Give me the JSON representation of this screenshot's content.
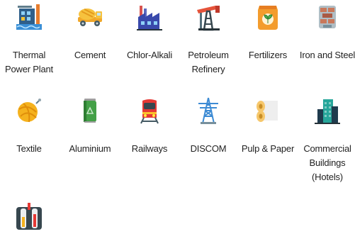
{
  "sectors": [
    {
      "label": "Thermal Power Plant",
      "icon": "thermal-power-plant-icon"
    },
    {
      "label": "Cement",
      "icon": "cement-mixer-truck-icon"
    },
    {
      "label": "Chlor-Alkali",
      "icon": "factory-icon"
    },
    {
      "label": "Petroleum Refinery",
      "icon": "oil-pump-jack-icon"
    },
    {
      "label": "Fertilizers",
      "icon": "fertilizer-bag-icon"
    },
    {
      "label": "Iron and Steel",
      "icon": "steel-bricks-icon"
    },
    {
      "label": "Textile",
      "icon": "yarn-ball-icon"
    },
    {
      "label": "Aluminium",
      "icon": "aluminium-can-icon"
    },
    {
      "label": "Railways",
      "icon": "train-icon"
    },
    {
      "label": "DISCOM",
      "icon": "transmission-tower-icon"
    },
    {
      "label": "Pulp & Paper",
      "icon": "paper-roll-icon"
    },
    {
      "label": "Commercial Buildings (Hotels)",
      "icon": "buildings-icon"
    },
    {
      "label": "",
      "icon": "refinery-tanks-icon"
    }
  ],
  "colors": {
    "label_text": "#222222"
  }
}
